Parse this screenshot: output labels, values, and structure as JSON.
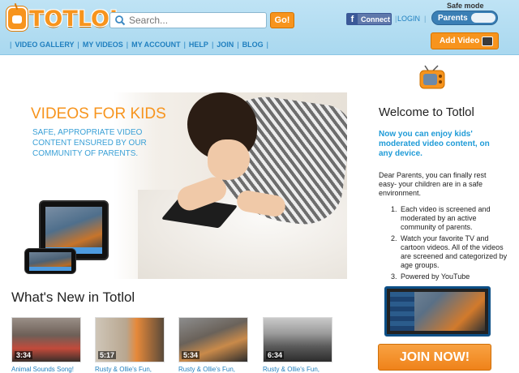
{
  "header": {
    "logo_text": "TOTLOL",
    "search": {
      "placeholder": "Search...",
      "go_label": "Go!"
    },
    "facebook": {
      "label": "Connect"
    },
    "login_label": "LOGIN",
    "safe_mode": {
      "label": "Safe mode",
      "toggle_value": "Parents"
    },
    "add_video_label": "Add Video",
    "nav": [
      "VIDEO GALLERY",
      "MY VIDEOS",
      "MY ACCOUNT",
      "HELP",
      "JOIN",
      "BLOG"
    ]
  },
  "hero": {
    "title": "VIDEOS FOR KIDS",
    "subtitle": "SAFE, APPROPRIATE VIDEO CONTENT ENSURED BY OUR COMMUNITY OF PARENTS."
  },
  "whats_new": {
    "heading": "What's New in Totlol",
    "videos": [
      {
        "duration": "3:34",
        "caption": "Animal Sounds Song!"
      },
      {
        "duration": "5:17",
        "caption": "Rusty & Ollie's Fun,"
      },
      {
        "duration": "5:34",
        "caption": "Rusty & Ollie's Fun,"
      },
      {
        "duration": "6:34",
        "caption": "Rusty & Ollie's Fun,"
      }
    ]
  },
  "sidebar": {
    "welcome_title": "Welcome to Totlol",
    "lead": "Now you can enjoy kids' moderated video content, on any device.",
    "intro": "Dear Parents, you can finally rest easy- your children are in a safe environment.",
    "benefits": [
      {
        "num": "1.",
        "text": "Each video is screened and moderated by an active community of parents."
      },
      {
        "num": "2.",
        "text": "Watch your favorite TV and cartoon videos. All of the videos are screened and categorized by age groups."
      },
      {
        "num": "3.",
        "text": "Powered by YouTube"
      }
    ],
    "join_label": "JOIN NOW!"
  },
  "colors": {
    "accent_orange": "#f7941d",
    "link_blue": "#1f7fbf",
    "header_blue": "#bfe3f5"
  }
}
